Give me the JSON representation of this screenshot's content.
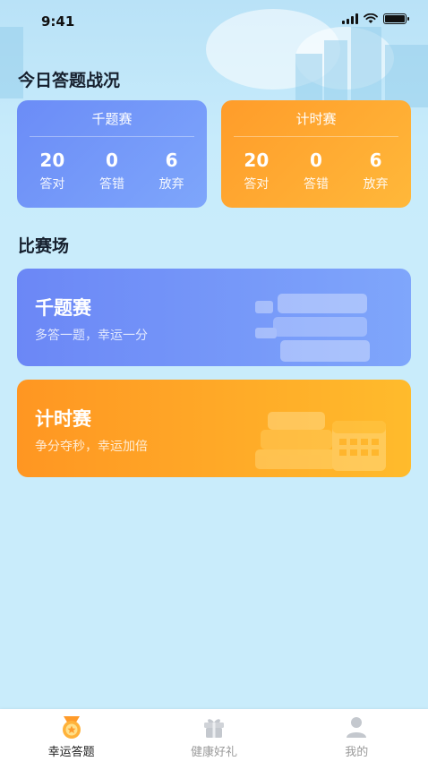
{
  "status_bar": {
    "time": "9:41"
  },
  "today_section": {
    "title": "今日答题战况"
  },
  "stat_cards": [
    {
      "title": "千题赛",
      "color": "#6b8cf7",
      "stats": [
        {
          "value": "20",
          "label": "答对"
        },
        {
          "value": "0",
          "label": "答错"
        },
        {
          "value": "6",
          "label": "放弃"
        }
      ]
    },
    {
      "title": "计时赛",
      "color": "#ff9c2a",
      "stats": [
        {
          "value": "20",
          "label": "答对"
        },
        {
          "value": "0",
          "label": "答错"
        },
        {
          "value": "6",
          "label": "放弃"
        }
      ]
    }
  ],
  "arena_section": {
    "title": "比赛场"
  },
  "arena_cards": [
    {
      "title": "千题赛",
      "subtitle": "多答一题，幸运一分",
      "icon": "books-icon",
      "color": "#6b87f6"
    },
    {
      "title": "计时赛",
      "subtitle": "争分夺秒，幸运加倍",
      "icon": "calendar-books-icon",
      "color": "#ff9622"
    }
  ],
  "tabbar": {
    "items": [
      {
        "label": "幸运答题",
        "icon": "medal-icon",
        "active": true
      },
      {
        "label": "健康好礼",
        "icon": "gift-icon",
        "active": false
      },
      {
        "label": "我的",
        "icon": "user-icon",
        "active": false
      }
    ]
  }
}
